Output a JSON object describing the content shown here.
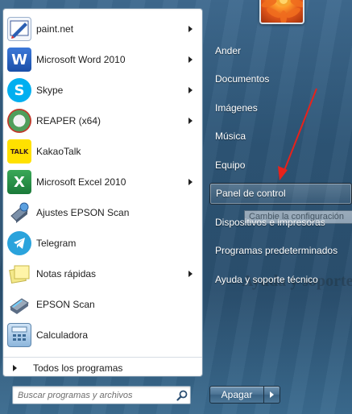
{
  "programs": [
    {
      "label": "paint.net",
      "icon": "paintnet-icon",
      "submenu": true
    },
    {
      "label": "Microsoft Word 2010",
      "icon": "word-icon",
      "submenu": true
    },
    {
      "label": "Skype",
      "icon": "skype-icon",
      "submenu": true
    },
    {
      "label": "REAPER (x64)",
      "icon": "reaper-icon",
      "submenu": true
    },
    {
      "label": "KakaoTalk",
      "icon": "kakaotalk-icon",
      "submenu": false
    },
    {
      "label": "Microsoft Excel 2010",
      "icon": "excel-icon",
      "submenu": true
    },
    {
      "label": "Ajustes EPSON Scan",
      "icon": "epson-settings-icon",
      "submenu": false
    },
    {
      "label": "Telegram",
      "icon": "telegram-icon",
      "submenu": false
    },
    {
      "label": "Notas rápidas",
      "icon": "sticky-notes-icon",
      "submenu": true
    },
    {
      "label": "EPSON Scan",
      "icon": "epson-scan-icon",
      "submenu": false
    },
    {
      "label": "Calculadora",
      "icon": "calculator-icon",
      "submenu": false
    }
  ],
  "all_programs_label": "Todos los programas",
  "search": {
    "placeholder": "Buscar programas y archivos"
  },
  "places": [
    {
      "label": "Ander"
    },
    {
      "label": "Documentos"
    },
    {
      "label": "Imágenes"
    },
    {
      "label": "Música"
    },
    {
      "label": "Equipo"
    },
    {
      "label": "Panel de control",
      "highlighted": true
    },
    {
      "label": "Dispositivos e impresoras"
    },
    {
      "label": "Programas predeterminados"
    },
    {
      "label": "Ayuda y soporte técnico"
    }
  ],
  "tooltip": "Cambie la configuración",
  "shutdown": {
    "label": "Apagar"
  },
  "background_text": [
    "Ayuda y soporte técnico Ayu"
  ],
  "colors": {
    "annotation_arrow": "#e8221b",
    "accent": "#2d5576"
  }
}
